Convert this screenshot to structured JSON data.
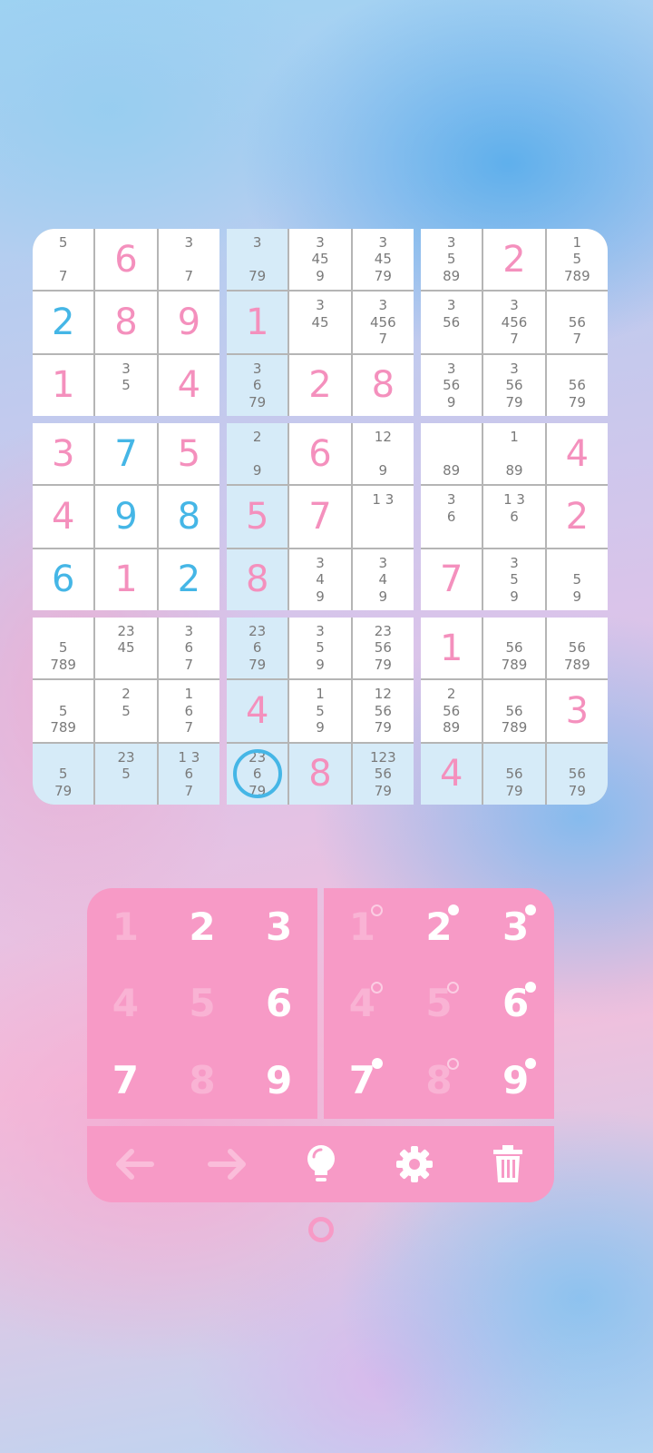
{
  "board": {
    "cells": [
      [
        {
          "v": "",
          "n": [
            "5",
            "",
            "7"
          ]
        },
        {
          "v": "6",
          "t": "given"
        },
        {
          "v": "",
          "n": [
            "3",
            "",
            "7"
          ]
        },
        {
          "v": "",
          "n": [
            "3",
            "",
            "79"
          ]
        },
        {
          "v": "",
          "n": [
            "3",
            "45",
            "9"
          ]
        },
        {
          "v": "",
          "n": [
            "3",
            "45",
            "79"
          ]
        },
        {
          "v": "",
          "n": [
            "3",
            "5",
            "89"
          ]
        },
        {
          "v": "2",
          "t": "given"
        },
        {
          "v": "",
          "n": [
            "1",
            "5",
            "789"
          ]
        }
      ],
      [
        {
          "v": "2",
          "t": "user"
        },
        {
          "v": "8",
          "t": "given"
        },
        {
          "v": "9",
          "t": "given"
        },
        {
          "v": "1",
          "t": "given"
        },
        {
          "v": "",
          "n": [
            "3",
            "45",
            ""
          ]
        },
        {
          "v": "",
          "n": [
            "3",
            "456",
            "7"
          ]
        },
        {
          "v": "",
          "n": [
            "3",
            "56",
            ""
          ]
        },
        {
          "v": "",
          "n": [
            "3",
            "456",
            "7"
          ]
        },
        {
          "v": "",
          "n": [
            "",
            "56",
            "7"
          ]
        }
      ],
      [
        {
          "v": "1",
          "t": "given"
        },
        {
          "v": "",
          "n": [
            "3",
            "5",
            ""
          ]
        },
        {
          "v": "4",
          "t": "given"
        },
        {
          "v": "",
          "n": [
            "3",
            "6",
            "79"
          ]
        },
        {
          "v": "2",
          "t": "given"
        },
        {
          "v": "8",
          "t": "given"
        },
        {
          "v": "",
          "n": [
            "3",
            "56",
            "9"
          ]
        },
        {
          "v": "",
          "n": [
            "3",
            "56",
            "79"
          ]
        },
        {
          "v": "",
          "n": [
            "",
            "56",
            "79"
          ]
        }
      ],
      [
        {
          "v": "3",
          "t": "given"
        },
        {
          "v": "7",
          "t": "user"
        },
        {
          "v": "5",
          "t": "given"
        },
        {
          "v": "",
          "n": [
            "2",
            "",
            "9"
          ]
        },
        {
          "v": "6",
          "t": "given"
        },
        {
          "v": "",
          "n": [
            "12",
            "",
            "9"
          ]
        },
        {
          "v": "",
          "n": [
            "",
            "",
            "89"
          ]
        },
        {
          "v": "",
          "n": [
            "1",
            "",
            "89"
          ]
        },
        {
          "v": "4",
          "t": "given"
        }
      ],
      [
        {
          "v": "4",
          "t": "given"
        },
        {
          "v": "9",
          "t": "user"
        },
        {
          "v": "8",
          "t": "user"
        },
        {
          "v": "5",
          "t": "given"
        },
        {
          "v": "7",
          "t": "given"
        },
        {
          "v": "",
          "n": [
            "1 3",
            "",
            ""
          ]
        },
        {
          "v": "",
          "n": [
            "3",
            "6",
            ""
          ]
        },
        {
          "v": "",
          "n": [
            "1 3",
            "6",
            ""
          ]
        },
        {
          "v": "2",
          "t": "given"
        }
      ],
      [
        {
          "v": "6",
          "t": "user"
        },
        {
          "v": "1",
          "t": "given"
        },
        {
          "v": "2",
          "t": "user"
        },
        {
          "v": "8",
          "t": "given"
        },
        {
          "v": "",
          "n": [
            "3",
            "4",
            "9"
          ]
        },
        {
          "v": "",
          "n": [
            "3",
            "4",
            "9"
          ]
        },
        {
          "v": "7",
          "t": "given"
        },
        {
          "v": "",
          "n": [
            "3",
            "5",
            "9"
          ]
        },
        {
          "v": "",
          "n": [
            "",
            "5",
            "9"
          ]
        }
      ],
      [
        {
          "v": "",
          "n": [
            "",
            "5",
            "789"
          ]
        },
        {
          "v": "",
          "n": [
            "23",
            "45",
            ""
          ]
        },
        {
          "v": "",
          "n": [
            "3",
            "6",
            "7"
          ]
        },
        {
          "v": "",
          "n": [
            "23",
            "6",
            "79"
          ]
        },
        {
          "v": "",
          "n": [
            "3",
            "5",
            "9"
          ]
        },
        {
          "v": "",
          "n": [
            "23",
            "56",
            "79"
          ]
        },
        {
          "v": "1",
          "t": "given"
        },
        {
          "v": "",
          "n": [
            "",
            "56",
            "789"
          ]
        },
        {
          "v": "",
          "n": [
            "",
            "56",
            "789"
          ]
        }
      ],
      [
        {
          "v": "",
          "n": [
            "",
            "5",
            "789"
          ]
        },
        {
          "v": "",
          "n": [
            "2",
            "5",
            ""
          ]
        },
        {
          "v": "",
          "n": [
            "1",
            "6",
            "7"
          ]
        },
        {
          "v": "4",
          "t": "given"
        },
        {
          "v": "",
          "n": [
            "1",
            "5",
            "9"
          ]
        },
        {
          "v": "",
          "n": [
            "12",
            "56",
            "79"
          ]
        },
        {
          "v": "",
          "n": [
            "2",
            "56",
            "89"
          ]
        },
        {
          "v": "",
          "n": [
            "",
            "56",
            "789"
          ]
        },
        {
          "v": "3",
          "t": "given"
        }
      ],
      [
        {
          "v": "",
          "n": [
            "",
            "5",
            "79"
          ]
        },
        {
          "v": "",
          "n": [
            "23",
            "5",
            ""
          ]
        },
        {
          "v": "",
          "n": [
            "1 3",
            "6",
            "7"
          ]
        },
        {
          "v": "",
          "n": [
            "23",
            "6",
            "79"
          ]
        },
        {
          "v": "8",
          "t": "given"
        },
        {
          "v": "",
          "n": [
            "123",
            "56",
            "79"
          ]
        },
        {
          "v": "4",
          "t": "given"
        },
        {
          "v": "",
          "n": [
            "",
            "56",
            "79"
          ]
        },
        {
          "v": "",
          "n": [
            "",
            "56",
            "79"
          ]
        }
      ]
    ],
    "selected": {
      "row": 8,
      "col": 3
    },
    "highlight_row": 8,
    "highlight_col": 3
  },
  "keypad_values": [
    {
      "label": "1",
      "active": false
    },
    {
      "label": "2",
      "active": true
    },
    {
      "label": "3",
      "active": true
    },
    {
      "label": "4",
      "active": false
    },
    {
      "label": "5",
      "active": false
    },
    {
      "label": "6",
      "active": true
    },
    {
      "label": "7",
      "active": true
    },
    {
      "label": "8",
      "active": false
    },
    {
      "label": "9",
      "active": true
    }
  ],
  "keypad_notes": [
    {
      "label": "1",
      "active": false,
      "dot": "hollow"
    },
    {
      "label": "2",
      "active": true,
      "dot": "filled"
    },
    {
      "label": "3",
      "active": true,
      "dot": "filled"
    },
    {
      "label": "4",
      "active": false,
      "dot": "hollow"
    },
    {
      "label": "5",
      "active": false,
      "dot": "hollow"
    },
    {
      "label": "6",
      "active": true,
      "dot": "filled"
    },
    {
      "label": "7",
      "active": true,
      "dot": "filled"
    },
    {
      "label": "8",
      "active": false,
      "dot": "hollow"
    },
    {
      "label": "9",
      "active": true,
      "dot": "filled"
    }
  ],
  "toolbar": {
    "undo_icon": "arrow-left-icon",
    "redo_icon": "arrow-right-icon",
    "hint_icon": "lightbulb-icon",
    "settings_icon": "gear-icon",
    "delete_icon": "trash-icon"
  },
  "colors": {
    "given": "#f490bd",
    "user": "#45b6e6",
    "pad": "#f79ac6",
    "highlight": "#d6ebf8"
  }
}
